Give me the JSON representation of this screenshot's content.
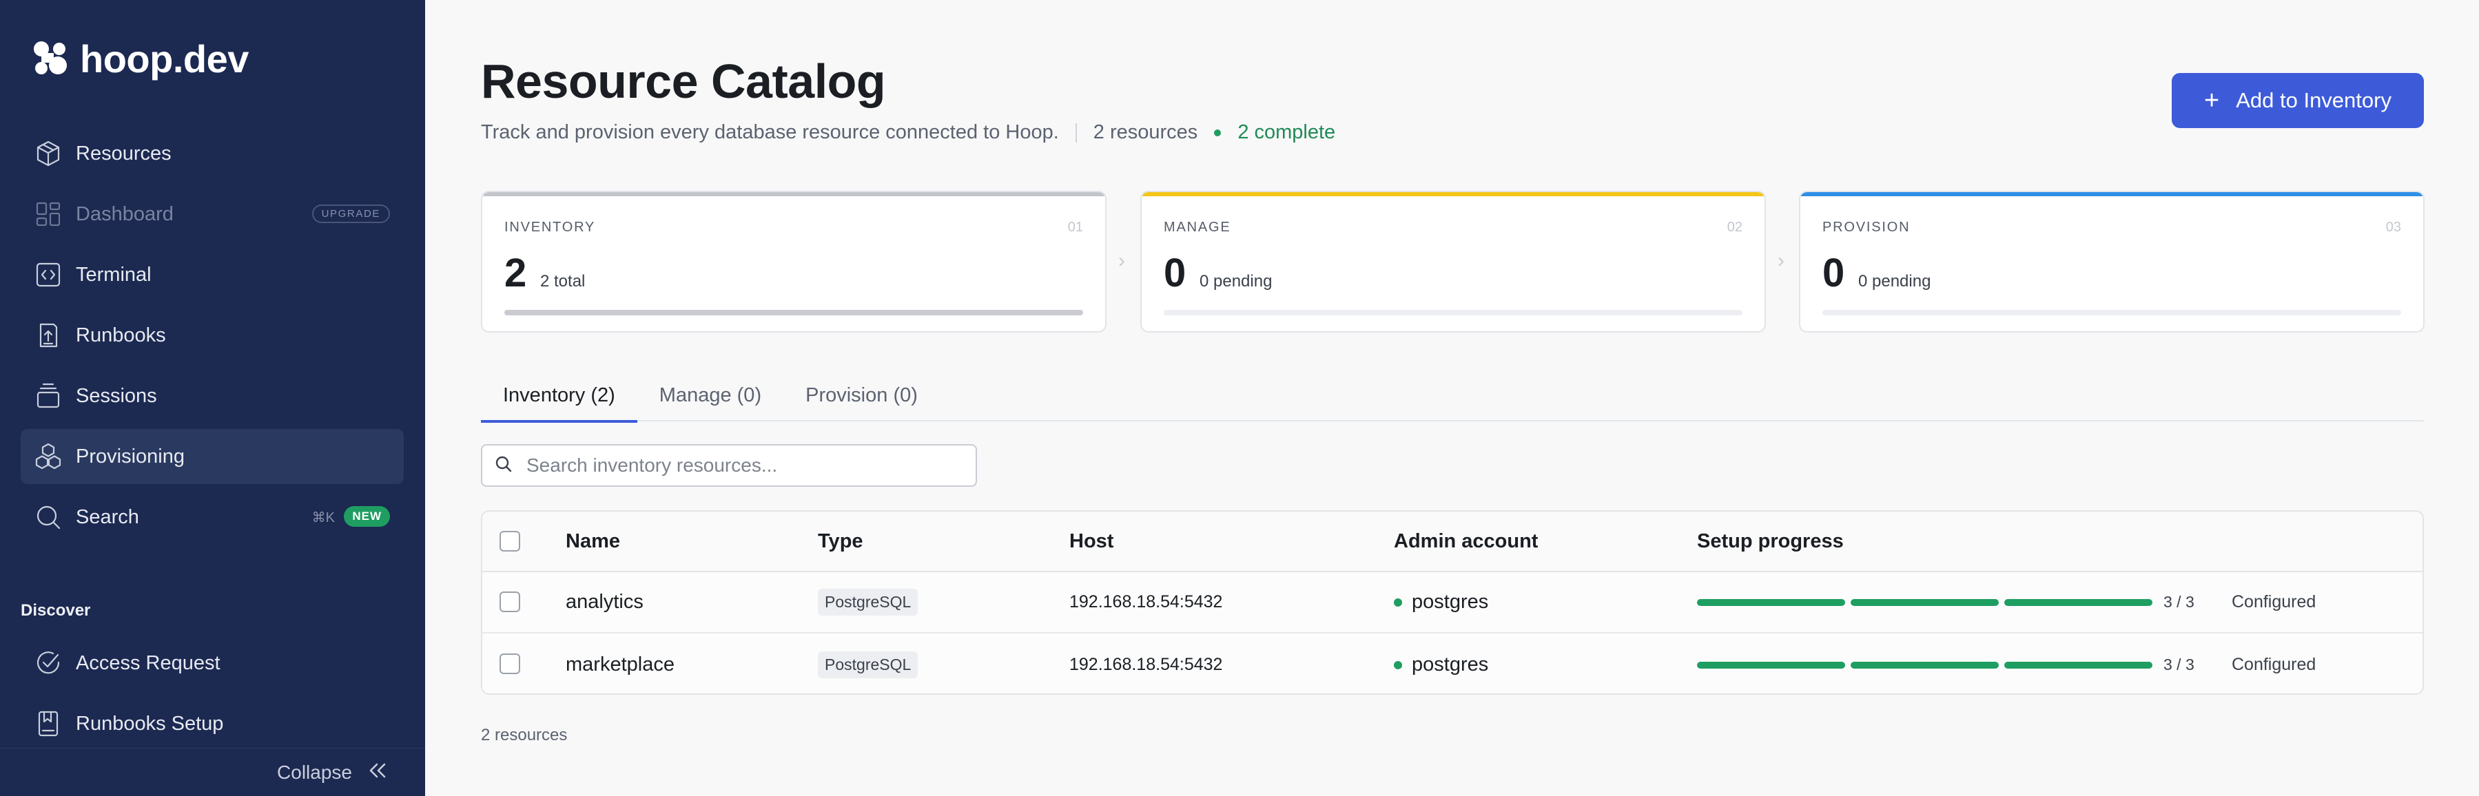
{
  "brand": {
    "name": "hoop.dev"
  },
  "sidebar": {
    "items": [
      {
        "label": "Resources",
        "icon": "cube-icon"
      },
      {
        "label": "Dashboard",
        "icon": "dashboard-icon",
        "badge": "UPGRADE"
      },
      {
        "label": "Terminal",
        "icon": "code-icon"
      },
      {
        "label": "Runbooks",
        "icon": "runbook-icon"
      },
      {
        "label": "Sessions",
        "icon": "sessions-icon"
      },
      {
        "label": "Provisioning",
        "icon": "provisioning-icon"
      },
      {
        "label": "Search",
        "icon": "search-icon",
        "shortcut": "⌘K",
        "badge": "NEW"
      }
    ],
    "discover_heading": "Discover",
    "discover_items": [
      {
        "label": "Access Request",
        "icon": "check-circle-icon"
      },
      {
        "label": "Runbooks Setup",
        "icon": "book-icon"
      }
    ],
    "collapse_label": "Collapse"
  },
  "header": {
    "title": "Resource Catalog",
    "subtitle": "Track and provision every database resource connected to Hoop.",
    "resource_count": "2 resources",
    "complete_count": "2 complete",
    "add_button": "Add to Inventory"
  },
  "stages": [
    {
      "label": "INVENTORY",
      "num": "01",
      "count": "2",
      "sub": "2 total",
      "color": "#c3c5cc",
      "fill": 1.0
    },
    {
      "label": "MANAGE",
      "num": "02",
      "count": "0",
      "sub": "0 pending",
      "color": "#f5c518",
      "fill": 0
    },
    {
      "label": "PROVISION",
      "num": "03",
      "count": "0",
      "sub": "0 pending",
      "color": "#2f8fe6",
      "fill": 0
    }
  ],
  "tabs": [
    "Inventory (2)",
    "Manage (0)",
    "Provision (0)"
  ],
  "search": {
    "placeholder": "Search inventory resources..."
  },
  "table": {
    "columns": [
      "Name",
      "Type",
      "Host",
      "Admin account",
      "Setup progress"
    ],
    "rows": [
      {
        "name": "analytics",
        "type": "PostgreSQL",
        "host": "192.168.18.54:5432",
        "admin": "postgres",
        "progress_done": 3,
        "progress_total": 3,
        "progress_text": "3 / 3",
        "status": "Configured"
      },
      {
        "name": "marketplace",
        "type": "PostgreSQL",
        "host": "192.168.18.54:5432",
        "admin": "postgres",
        "progress_done": 3,
        "progress_total": 3,
        "progress_text": "3 / 3",
        "status": "Configured"
      }
    ]
  },
  "footer": {
    "count": "2 resources"
  }
}
